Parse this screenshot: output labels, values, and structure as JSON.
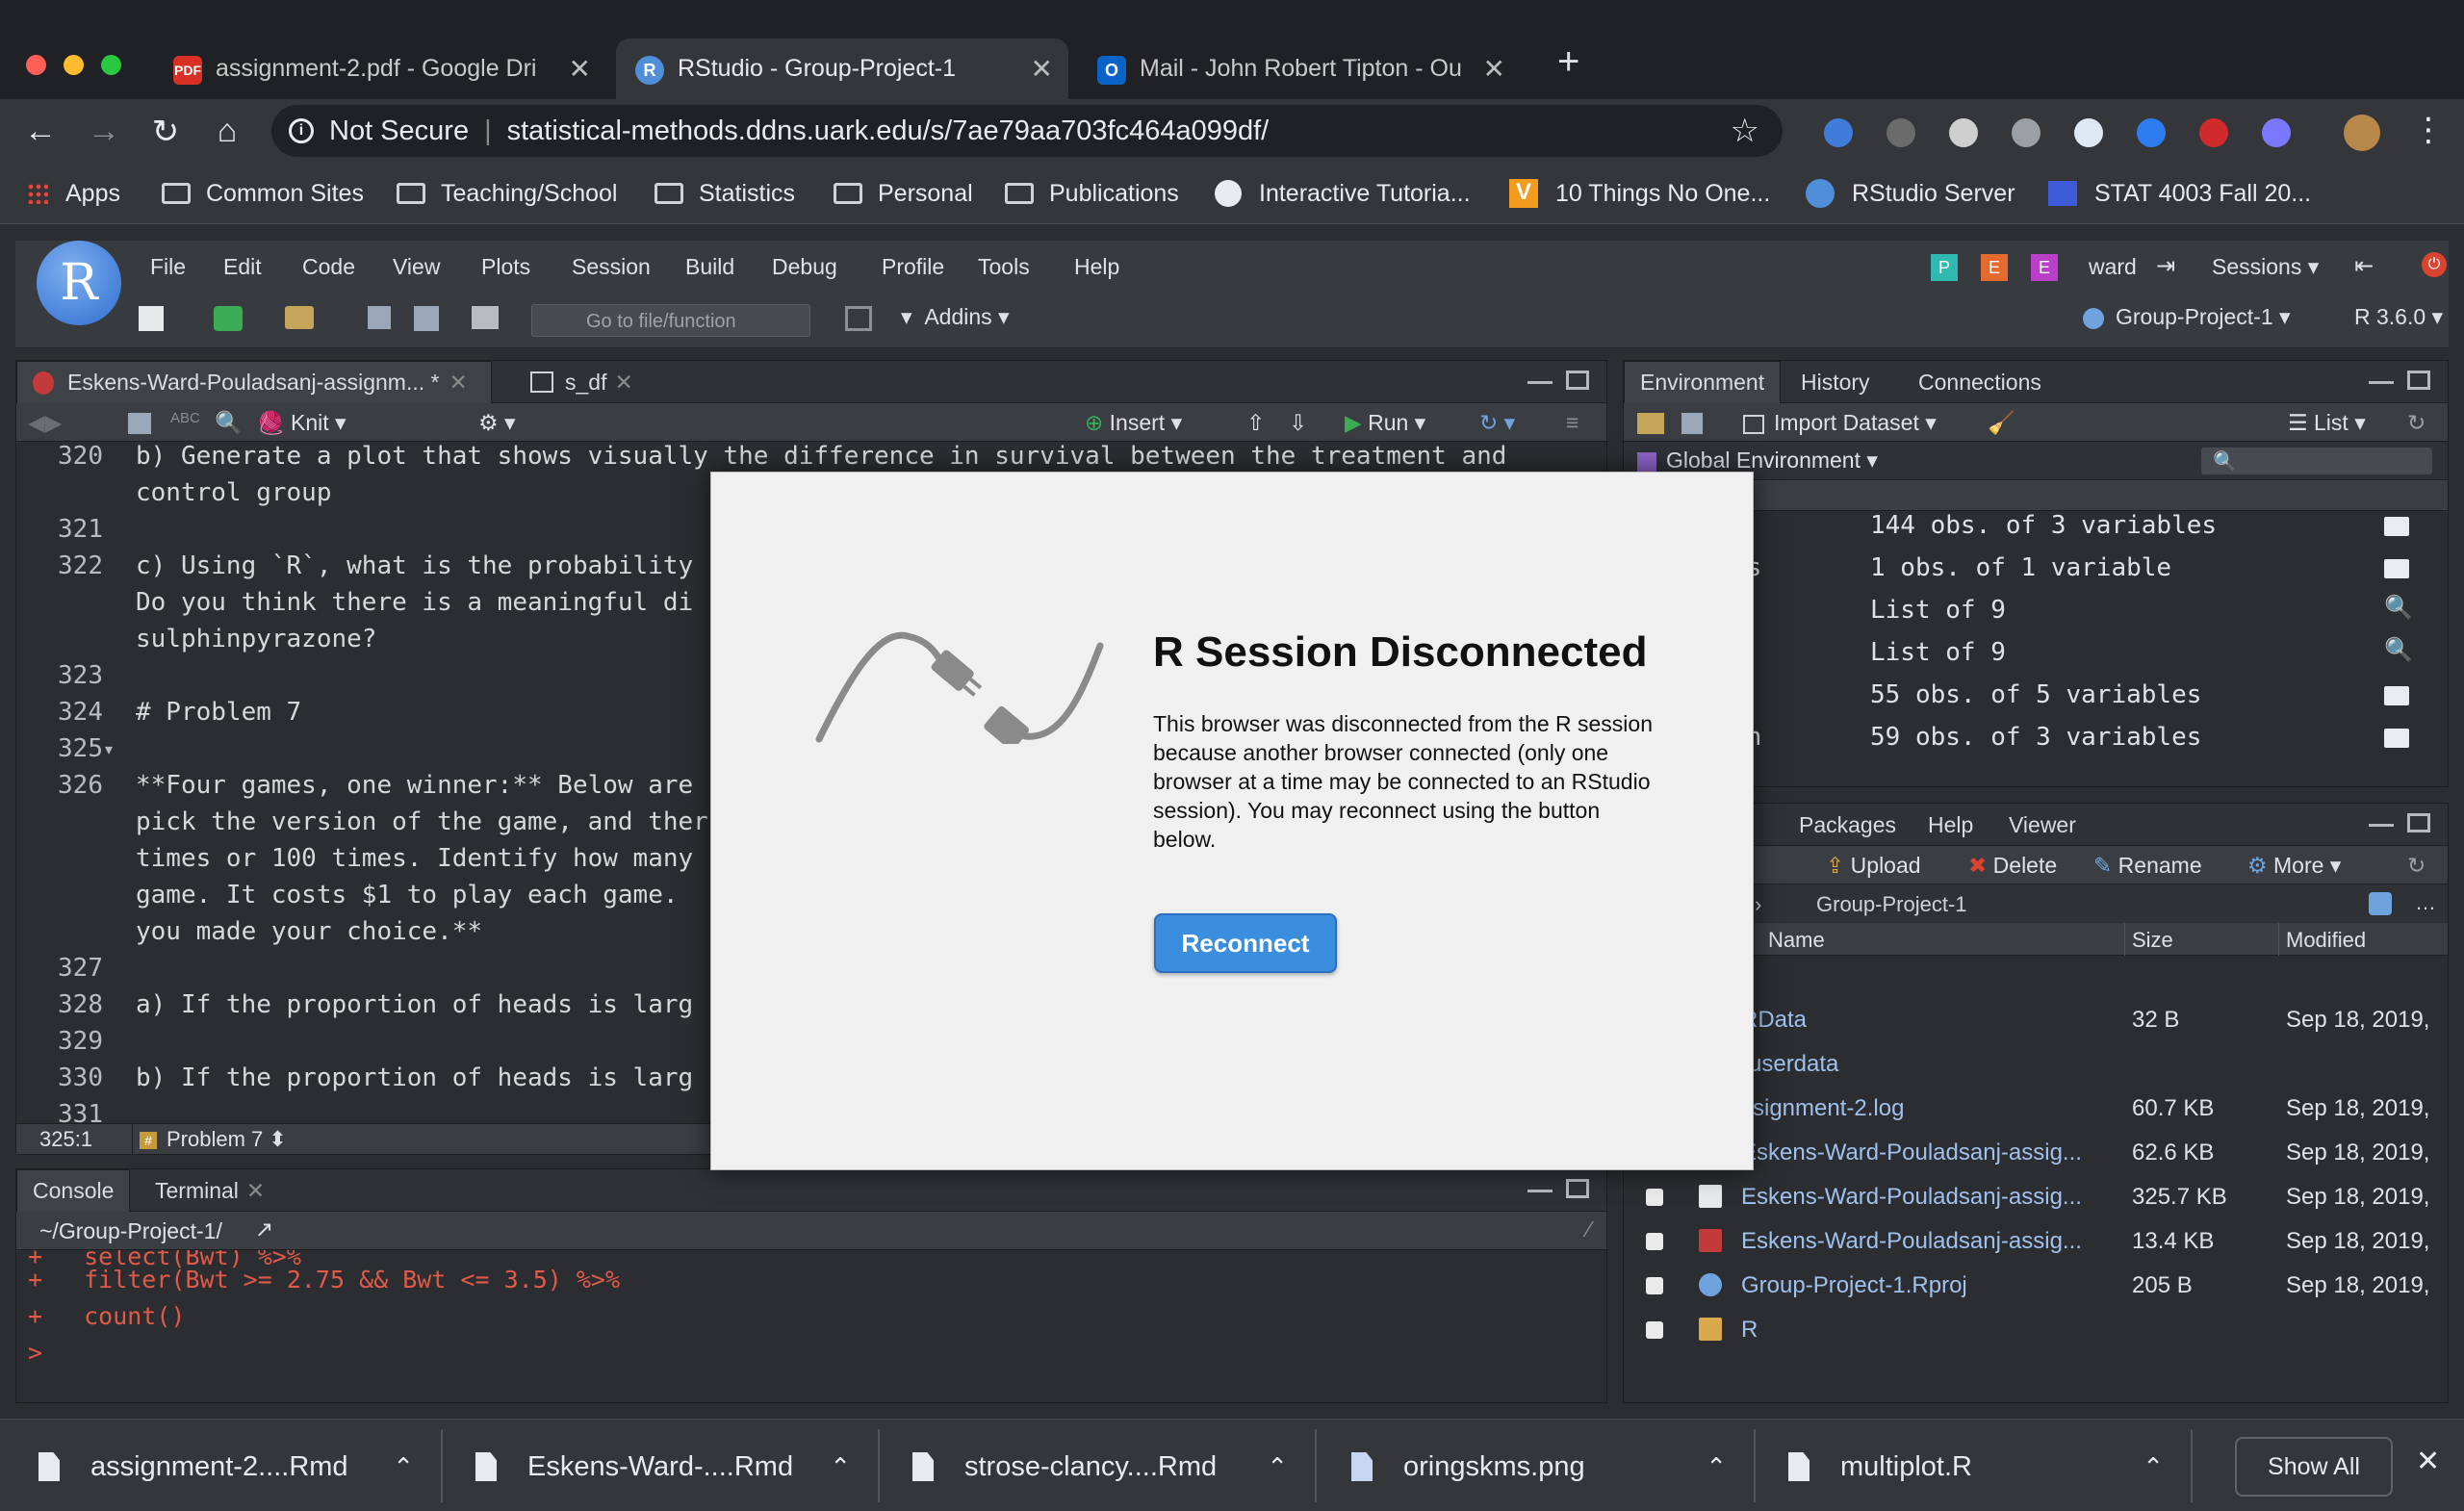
{
  "browser": {
    "tabs": [
      {
        "label": "assignment-2.pdf - Google Dri",
        "favicon": "PDF"
      },
      {
        "label": "RStudio - Group-Project-1",
        "favicon": "R"
      },
      {
        "label": "Mail - John Robert Tipton - Ou",
        "favicon": "O"
      }
    ],
    "security": "Not Secure",
    "url": "statistical-methods.ddns.uark.edu/s/7ae79aa703fc464a099df/",
    "bookmarks": [
      "Apps",
      "Common Sites",
      "Teaching/School",
      "Statistics",
      "Personal",
      "Publications",
      "Interactive Tutoria...",
      "10 Things No One...",
      "RStudio Server",
      "STAT 4003 Fall 20..."
    ]
  },
  "rstudio": {
    "menu": [
      "File",
      "Edit",
      "Code",
      "View",
      "Plots",
      "Session",
      "Build",
      "Debug",
      "Profile",
      "Tools",
      "Help"
    ],
    "user_badges": [
      "P",
      "E",
      "E"
    ],
    "user": "ward",
    "sessions": "Sessions",
    "goto_placeholder": "Go to file/function",
    "addins": "Addins",
    "project": "Group-Project-1",
    "r_version": "R 3.6.0",
    "editor": {
      "tabs": [
        "Eskens-Ward-Pouladsanj-assignm... *",
        "s_df"
      ],
      "knit": "Knit",
      "insert": "Insert",
      "run": "Run",
      "lines": [
        {
          "n": "320",
          "t": "b) Generate a plot that shows visually the difference in survival between the treatment and"
        },
        {
          "n": "",
          "t": "control group"
        },
        {
          "n": "321",
          "t": ""
        },
        {
          "n": "322",
          "t": "c) Using `R`, what is the probability"
        },
        {
          "n": "",
          "t": "Do you think there is a meaningful di"
        },
        {
          "n": "",
          "t": "sulphinpyrazone?"
        },
        {
          "n": "323",
          "t": ""
        },
        {
          "n": "324",
          "t": "# Problem 7"
        },
        {
          "n": "325",
          "t": ""
        },
        {
          "n": "326",
          "t": "**Four games, one winner:** Below are"
        },
        {
          "n": "",
          "t": "pick the version of the game, and ther"
        },
        {
          "n": "",
          "t": "times or 100 times. Identify how many"
        },
        {
          "n": "",
          "t": "game. It costs $1 to play each game."
        },
        {
          "n": "",
          "t": "you made your choice.**"
        },
        {
          "n": "327",
          "t": ""
        },
        {
          "n": "328",
          "t": "a) If the proportion of heads is larg"
        },
        {
          "n": "329",
          "t": ""
        },
        {
          "n": "330",
          "t": "b) If the proportion of heads is larg"
        },
        {
          "n": "331",
          "t": ""
        }
      ],
      "status_pos": "325:1",
      "status_section": "Problem 7"
    },
    "console": {
      "tabs": [
        "Console",
        "Terminal"
      ],
      "path": "~/Group-Project-1/",
      "lines": [
        {
          "p": "+",
          "t": "  select(Bwt) %>%"
        },
        {
          "p": "+",
          "t": "  filter(Bwt >= 2.75 && Bwt <= 3.5) %>%"
        },
        {
          "p": "+",
          "t": "  count()"
        },
        {
          "p": ">",
          "t": ""
        }
      ]
    },
    "environment": {
      "tabs": [
        "Environment",
        "History",
        "Connections"
      ],
      "import": "Import Dataset",
      "list_view": "List",
      "scope": "Global Environment",
      "rows": [
        {
          "name": "",
          "value": "144 obs. of 3 variables",
          "icon": "table"
        },
        {
          "name": "ts",
          "value": "1 obs. of 1 variable",
          "icon": "table"
        },
        {
          "name": "",
          "value": "List of 9",
          "icon": "search"
        },
        {
          "name": "",
          "value": "List of 9",
          "icon": "search"
        },
        {
          "name": "",
          "value": "55 obs. of 5 variables",
          "icon": "table"
        },
        {
          "name": "on",
          "value": "59 obs. of 3 variables",
          "icon": "table"
        }
      ]
    },
    "files": {
      "tabs": [
        "ts",
        "Packages",
        "Help",
        "Viewer"
      ],
      "toolbar": [
        "lder",
        "Upload",
        "Delete",
        "Rename",
        "More"
      ],
      "breadcrumb_home": "me",
      "breadcrumb_folder": "Group-Project-1",
      "headers": [
        "Name",
        "Size",
        "Modified"
      ],
      "rows": [
        {
          "name": "",
          "size": "",
          "mod": ""
        },
        {
          "name": "RData",
          "size": "32 B",
          "mod": "Sep 18, 2019,"
        },
        {
          "name": "ruserdata",
          "size": "",
          "mod": ""
        },
        {
          "name": "ssignment-2.log",
          "size": "60.7 KB",
          "mod": "Sep 18, 2019,"
        },
        {
          "name": "Eskens-Ward-Pouladsanj-assig...",
          "size": "62.6 KB",
          "mod": "Sep 18, 2019,"
        },
        {
          "name": "Eskens-Ward-Pouladsanj-assig...",
          "size": "325.7 KB",
          "mod": "Sep 18, 2019,"
        },
        {
          "name": "Eskens-Ward-Pouladsanj-assig...",
          "size": "13.4 KB",
          "mod": "Sep 18, 2019,"
        },
        {
          "name": "Group-Project-1.Rproj",
          "size": "205 B",
          "mod": "Sep 18, 2019,"
        },
        {
          "name": "R",
          "size": "",
          "mod": ""
        }
      ]
    }
  },
  "dialog": {
    "title": "R Session Disconnected",
    "body": "This browser was disconnected from the R session because another browser connected (only one browser at a time may be connected to an RStudio session). You may reconnect using the button below.",
    "button": "Reconnect"
  },
  "downloads": {
    "items": [
      "assignment-2....Rmd",
      "Eskens-Ward-....Rmd",
      "strose-clancy....Rmd",
      "oringskms.png",
      "multiplot.R"
    ],
    "show_all": "Show All"
  }
}
